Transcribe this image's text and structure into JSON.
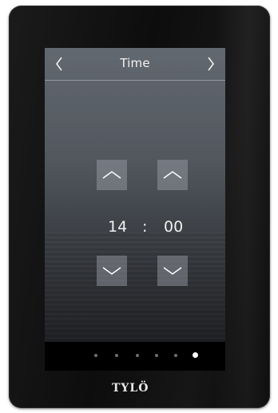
{
  "screen": {
    "title": "Time",
    "prev_icon": "chevron-left-icon",
    "next_icon": "chevron-right-icon"
  },
  "time": {
    "hours": "14",
    "separator": ":",
    "minutes": "00"
  },
  "controls": {
    "increase_icon": "chevron-up-icon",
    "decrease_icon": "chevron-down-icon"
  },
  "pagination": {
    "total": 6,
    "active_index": 5
  },
  "brand": {
    "logo": "TYLÖ"
  },
  "colors": {
    "active_dot": "#ffffff",
    "inactive_dot": "#6f6f6f",
    "button_bg": "#a0a5ac"
  }
}
